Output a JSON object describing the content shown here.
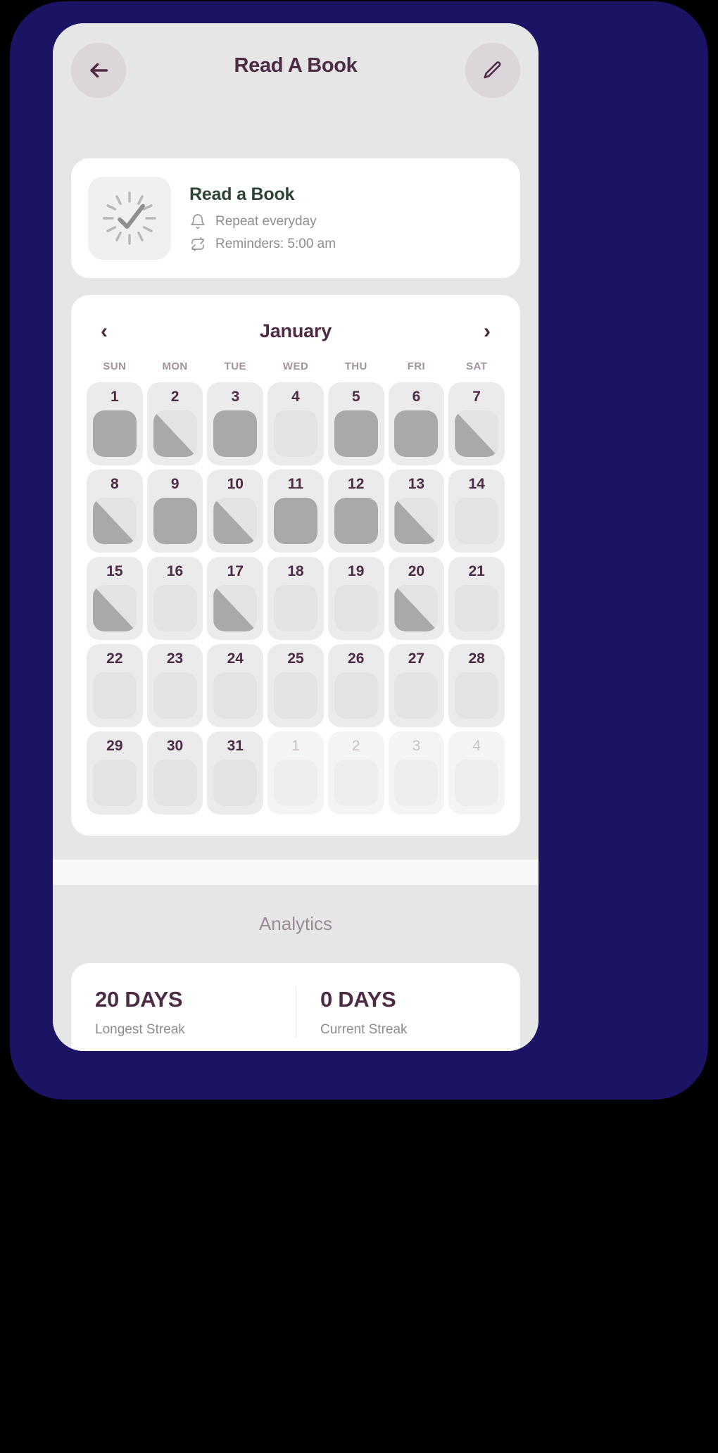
{
  "header": {
    "title": "Read A Book",
    "back_icon": "arrow-left-icon",
    "edit_icon": "pencil-icon"
  },
  "habit": {
    "name": "Read a Book",
    "icon": "clock-check-icon",
    "repeat_icon": "bell-icon",
    "repeat_text": "Repeat everyday",
    "reminder_icon": "repeat-icon",
    "reminder_text": "Reminders: 5:00 am"
  },
  "calendar": {
    "month": "January",
    "prev_icon": "chevron-left-icon",
    "next_icon": "chevron-right-icon",
    "weekdays": [
      "SUN",
      "MON",
      "TUE",
      "WED",
      "THU",
      "FRI",
      "SAT"
    ],
    "days": [
      {
        "n": "1",
        "state": "full",
        "outside": false
      },
      {
        "n": "2",
        "state": "half",
        "outside": false
      },
      {
        "n": "3",
        "state": "full",
        "outside": false
      },
      {
        "n": "4",
        "state": "empty",
        "outside": false
      },
      {
        "n": "5",
        "state": "full",
        "outside": false
      },
      {
        "n": "6",
        "state": "full",
        "outside": false
      },
      {
        "n": "7",
        "state": "half",
        "outside": false
      },
      {
        "n": "8",
        "state": "half",
        "outside": false
      },
      {
        "n": "9",
        "state": "full",
        "outside": false
      },
      {
        "n": "10",
        "state": "half",
        "outside": false
      },
      {
        "n": "11",
        "state": "full",
        "outside": false
      },
      {
        "n": "12",
        "state": "full",
        "outside": false
      },
      {
        "n": "13",
        "state": "half",
        "outside": false
      },
      {
        "n": "14",
        "state": "empty",
        "outside": false
      },
      {
        "n": "15",
        "state": "half",
        "outside": false
      },
      {
        "n": "16",
        "state": "empty",
        "outside": false
      },
      {
        "n": "17",
        "state": "half",
        "outside": false
      },
      {
        "n": "18",
        "state": "empty",
        "outside": false
      },
      {
        "n": "19",
        "state": "empty",
        "outside": false
      },
      {
        "n": "20",
        "state": "half",
        "outside": false
      },
      {
        "n": "21",
        "state": "empty",
        "outside": false
      },
      {
        "n": "22",
        "state": "empty",
        "outside": false
      },
      {
        "n": "23",
        "state": "empty",
        "outside": false
      },
      {
        "n": "24",
        "state": "empty",
        "outside": false
      },
      {
        "n": "25",
        "state": "empty",
        "outside": false
      },
      {
        "n": "26",
        "state": "empty",
        "outside": false
      },
      {
        "n": "27",
        "state": "empty",
        "outside": false
      },
      {
        "n": "28",
        "state": "empty",
        "outside": false
      },
      {
        "n": "29",
        "state": "empty",
        "outside": false
      },
      {
        "n": "30",
        "state": "empty",
        "outside": false
      },
      {
        "n": "31",
        "state": "empty",
        "outside": false
      },
      {
        "n": "1",
        "state": "empty",
        "outside": true
      },
      {
        "n": "2",
        "state": "empty",
        "outside": true
      },
      {
        "n": "3",
        "state": "empty",
        "outside": true
      },
      {
        "n": "4",
        "state": "empty",
        "outside": true
      }
    ]
  },
  "analytics": {
    "title": "Analytics",
    "stats": [
      {
        "value": "20 DAYS",
        "label": "Longest Streak"
      },
      {
        "value": "0 DAYS",
        "label": "Current Streak"
      }
    ]
  },
  "colors": {
    "frame": "#1b1464",
    "screen_bg": "#e6e6e6",
    "accent_purple": "#4d2b45",
    "habit_green": "#2d4434",
    "mark_filled": "#a9a9a9"
  }
}
